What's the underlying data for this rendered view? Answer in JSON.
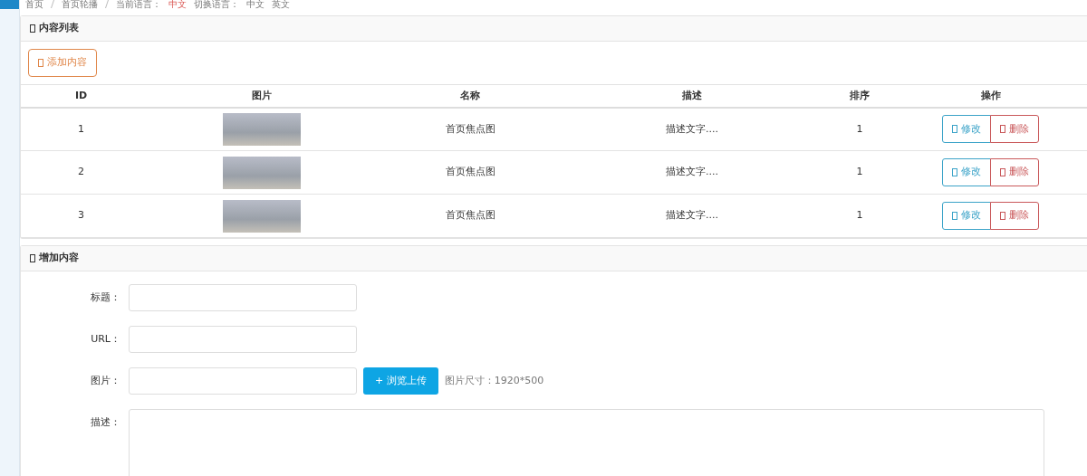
{
  "breadcrumb": {
    "items": [
      "首页",
      "首页轮播"
    ],
    "current_label": "当前语言：",
    "current_language": "中文",
    "switch_label": "切换语言：",
    "languages": [
      "中文",
      "英文"
    ]
  },
  "list_panel": {
    "title": "内容列表",
    "add_button": "添加内容",
    "table": {
      "columns": [
        "ID",
        "图片",
        "名称",
        "描述",
        "排序",
        "操作"
      ],
      "rows": [
        {
          "id": "1",
          "name": "首页焦点图",
          "description": "描述文字....",
          "sort": "1",
          "edit_button": "修改",
          "delete_button": "删除"
        },
        {
          "id": "2",
          "name": "首页焦点图",
          "description": "描述文字....",
          "sort": "1",
          "edit_button": "修改",
          "delete_button": "删除"
        },
        {
          "id": "3",
          "name": "首页焦点图",
          "description": "描述文字....",
          "sort": "1",
          "edit_button": "修改",
          "delete_button": "删除"
        }
      ]
    }
  },
  "form_panel": {
    "title": "增加内容",
    "fields": [
      {
        "kind": "text",
        "label": "标题："
      },
      {
        "kind": "text",
        "label": "URL："
      },
      {
        "kind": "upload",
        "label": "图片：",
        "button": "+ 浏览上传",
        "hint": "图片尺寸：1920*500"
      },
      {
        "kind": "textarea",
        "label": "描述："
      }
    ]
  }
}
